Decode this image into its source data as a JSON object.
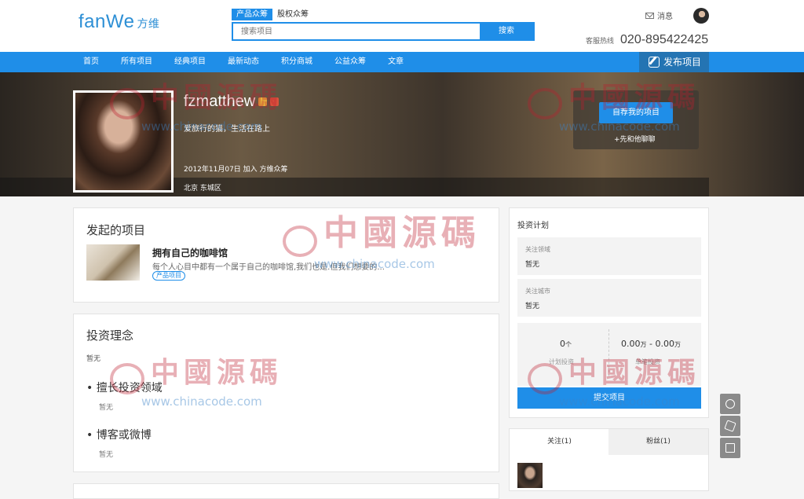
{
  "header": {
    "logo_text": "fanWe",
    "logo_cn": "方维",
    "search_tabs": [
      "产品众筹",
      "股权众筹"
    ],
    "search_placeholder": "搜索项目",
    "search_button": "搜索",
    "messages_label": "消息",
    "hotline_label": "客服热线",
    "hotline_number": "020-895422425"
  },
  "nav": {
    "items": [
      "首页",
      "所有项目",
      "经典项目",
      "最新动态",
      "积分商城",
      "公益众筹",
      "文章"
    ],
    "publish_label": "发布项目"
  },
  "profile": {
    "username": "fzmatthew",
    "motto": "爱旅行的猫，生活在路上",
    "joined": "2012年11月07日 加入 方维众筹",
    "location": "北京 东城区",
    "recommend_button": "自荐我的项目",
    "chat_link": "+先和他聊聊"
  },
  "projects": {
    "title": "发起的项目",
    "items": [
      {
        "name": "拥有自己的咖啡馆",
        "desc": "每个人心目中都有一个属于自己的咖啡馆,我们也是.但我们想要的...",
        "tag": "产品项目"
      }
    ]
  },
  "philosophy": {
    "title": "投资理念",
    "value": "暂无",
    "sections": [
      {
        "label": "擅长投资领域",
        "value": "暂无"
      },
      {
        "label": "博客或微博",
        "value": "暂无"
      }
    ]
  },
  "plan": {
    "title": "投资计划",
    "focus_field_label": "关注领域",
    "focus_field_value": "暂无",
    "focus_city_label": "关注城市",
    "focus_city_value": "暂无",
    "count_value": "0",
    "count_unit": "个",
    "count_label": "计划投资",
    "amount_low": "0.00",
    "amount_high": "0.00",
    "amount_unit": "万",
    "amount_label": "单笔投资",
    "submit_button": "提交项目"
  },
  "follow": {
    "tabs": [
      "关注(1)",
      "粉丝(1)"
    ]
  },
  "watermark": {
    "cn": "中國源碼",
    "url": "www.chinacode.com"
  }
}
